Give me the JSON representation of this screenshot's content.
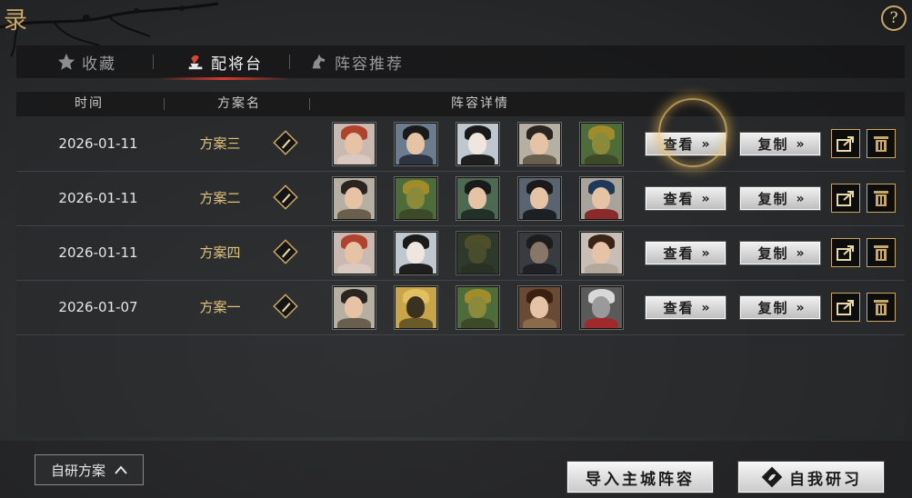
{
  "corner_char": "录",
  "help_label": "?",
  "tabs": [
    {
      "label": "收藏",
      "icon": "star-icon",
      "active": false
    },
    {
      "label": "配将台",
      "icon": "forge-icon",
      "active": true
    },
    {
      "label": "阵容推荐",
      "icon": "horse-icon",
      "active": false
    }
  ],
  "table": {
    "headers": {
      "time": "时间",
      "name": "方案名",
      "details": "阵容详情"
    },
    "rows": [
      {
        "date": "2026-01-11",
        "name": "方案三",
        "heroes": [
          "hero-red-hair-woman",
          "hero-young-man",
          "hero-pale-man",
          "hero-bearded-elder",
          "hero-green-armor"
        ]
      },
      {
        "date": "2026-01-11",
        "name": "方案二",
        "heroes": [
          "hero-bearded-elder",
          "hero-green-armor",
          "hero-young-man",
          "hero-dark-robe",
          "hero-headband-man"
        ]
      },
      {
        "date": "2026-01-11",
        "name": "方案四",
        "heroes": [
          "hero-red-hair-woman",
          "hero-pale-man",
          "hero-green-armor",
          "hero-dark-robe",
          "hero-long-hair-woman"
        ]
      },
      {
        "date": "2026-01-07",
        "name": "方案一",
        "heroes": [
          "hero-bearded-elder",
          "hero-gold-helmet",
          "hero-green-armor",
          "hero-brown-hair-woman",
          "hero-white-beast"
        ]
      }
    ],
    "view_label": "查看",
    "copy_label": "复制",
    "arrow": "»"
  },
  "bottom": {
    "self_plan_label": "自研方案",
    "import_label": "导入主城阵容",
    "research_label": "自我研习"
  },
  "colors": {
    "accent_gold": "#c9a766",
    "tab_underline": "#d83a2c",
    "name_gold": "#e0c27a"
  }
}
